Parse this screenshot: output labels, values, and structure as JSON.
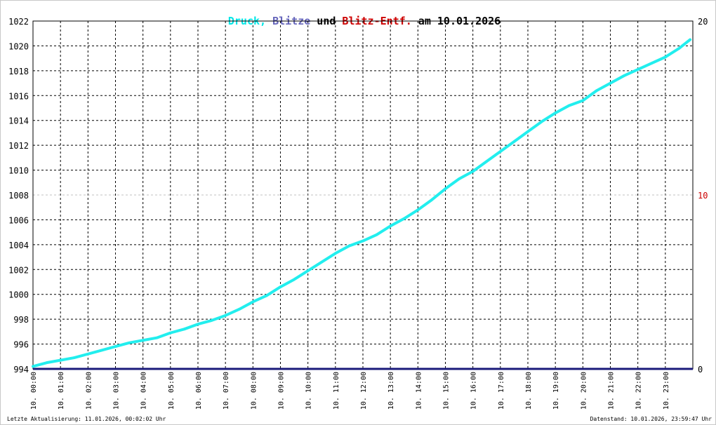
{
  "title": {
    "parts": [
      {
        "text": "Druck",
        "color": "#00e5e5"
      },
      {
        "text": ", ",
        "color": "#00e5e5"
      },
      {
        "text": "Blitze",
        "color": "#6666bb"
      },
      {
        "text": " und ",
        "color": "#000000"
      },
      {
        "text": "Blitz-Entf.",
        "color": "#cc0000"
      },
      {
        "text": " am 10.01.2026",
        "color": "#000000"
      }
    ]
  },
  "footer": {
    "left": "Letzte Aktualisierung: 11.01.2026, 00:02:02 Uhr",
    "right": "Datenstand: 10.01.2026, 23:59:47 Uhr"
  },
  "colors": {
    "pressure": "#22eeee",
    "lightning": "#1a1a7a",
    "right_axis_label": "#cc0000",
    "grid": "#000000",
    "midline": "#c0c0c0"
  },
  "chart_data": {
    "type": "line",
    "x_ticks": [
      "10. 00:00",
      "10. 01:00",
      "10. 02:00",
      "10. 03:00",
      "10. 04:00",
      "10. 05:00",
      "10. 06:00",
      "10. 07:00",
      "10. 08:00",
      "10. 09:00",
      "10. 10:00",
      "10. 11:00",
      "10. 12:00",
      "10. 13:00",
      "10. 14:00",
      "10. 15:00",
      "10. 16:00",
      "10. 17:00",
      "10. 18:00",
      "10. 19:00",
      "10. 20:00",
      "10. 21:00",
      "10. 22:00",
      "10. 23:00"
    ],
    "x_range_hours": [
      0,
      24
    ],
    "y_left": {
      "range": [
        994,
        1022
      ],
      "ticks": [
        994,
        996,
        998,
        1000,
        1002,
        1004,
        1006,
        1008,
        1010,
        1012,
        1014,
        1016,
        1018,
        1020,
        1022
      ]
    },
    "y_right": {
      "range": [
        0,
        20
      ],
      "ticks": [
        {
          "value": 0,
          "label": "0"
        },
        {
          "value": 10,
          "label": "10"
        },
        {
          "value": 20,
          "label": "20"
        }
      ]
    },
    "grid": true,
    "series": [
      {
        "name": "Druck",
        "axis": "left",
        "x": [
          0,
          0.5,
          1,
          1.5,
          2,
          2.5,
          3,
          3.5,
          4,
          4.5,
          5,
          5.5,
          6,
          6.5,
          7,
          7.5,
          8,
          8.5,
          9,
          9.5,
          10,
          10.5,
          11,
          11.5,
          12,
          12.5,
          13,
          13.5,
          14,
          14.5,
          15,
          15.5,
          16,
          16.5,
          17,
          17.5,
          18,
          18.5,
          19,
          19.5,
          20,
          20.5,
          21,
          21.5,
          22,
          22.5,
          23,
          23.5,
          23.9
        ],
        "values": [
          994.2,
          994.5,
          994.7,
          994.9,
          995.2,
          995.5,
          995.8,
          996.1,
          996.3,
          996.5,
          996.9,
          997.2,
          997.6,
          997.9,
          998.3,
          998.8,
          999.4,
          999.9,
          1000.6,
          1001.2,
          1001.9,
          1002.6,
          1003.3,
          1003.9,
          1004.3,
          1004.8,
          1005.5,
          1006.1,
          1006.8,
          1007.6,
          1008.5,
          1009.3,
          1009.9,
          1010.7,
          1011.5,
          1012.3,
          1013.1,
          1013.9,
          1014.6,
          1015.2,
          1015.6,
          1016.4,
          1017.0,
          1017.6,
          1018.1,
          1018.6,
          1019.1,
          1019.8,
          1020.5
        ]
      },
      {
        "name": "Blitze",
        "axis": "right",
        "x": [
          0,
          24
        ],
        "values": [
          0,
          0
        ]
      }
    ]
  }
}
